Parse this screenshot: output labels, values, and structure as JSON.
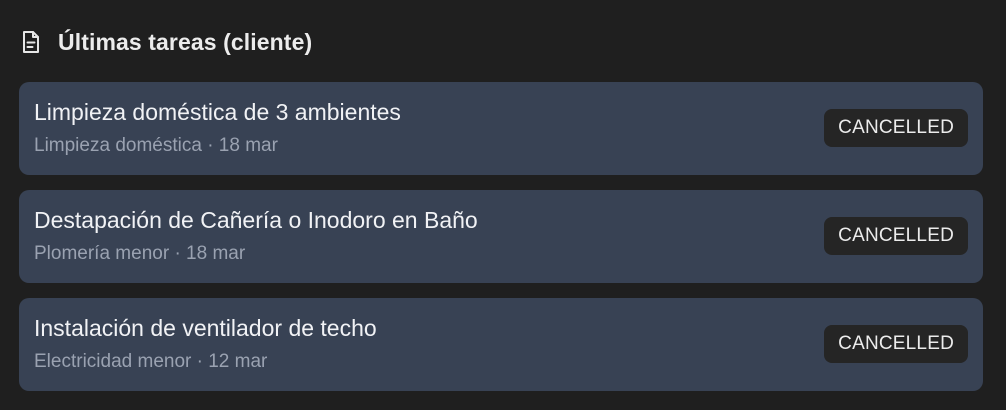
{
  "header": {
    "icon": "document-icon",
    "title": "Últimas tareas (cliente)"
  },
  "tasks": [
    {
      "title": "Limpieza doméstica de 3 ambientes",
      "meta": "Limpieza doméstica · 18 mar",
      "status": "CANCELLED"
    },
    {
      "title": "Destapación de Cañería o Inodoro en Baño",
      "meta": "Plomería menor · 18 mar",
      "status": "CANCELLED"
    },
    {
      "title": "Instalación de ventilador de techo",
      "meta": "Electricidad menor · 12 mar",
      "status": "CANCELLED"
    }
  ],
  "colors": {
    "background": "#1f1f1f",
    "card": "#384254",
    "badge": "#252525",
    "meta_text": "#9aa2b1"
  }
}
